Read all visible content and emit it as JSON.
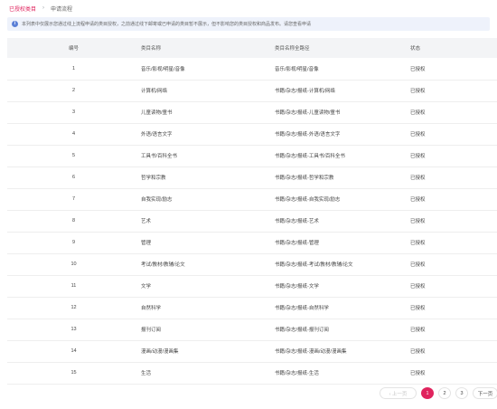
{
  "breadcrumb": {
    "current": "已授权类目",
    "next": "申请流程"
  },
  "notice": {
    "text": "本列表中仅展示您通过线上流程申请的类目授权，之前通过线下邮寄或已申请的类目暂不展示，但不影响您的类目授权和商品发布。请您查看申请"
  },
  "table": {
    "headers": [
      "编号",
      "类目名称",
      "类目名称全路径",
      "状态"
    ],
    "rows": [
      [
        "1",
        "音乐/影视/明星/音像",
        "音乐/影视/明星/音像",
        "已授权"
      ],
      [
        "2",
        "计算机/网络",
        "书籍/杂志/报纸-计算机/网络",
        "已授权"
      ],
      [
        "3",
        "儿童读物/童书",
        "书籍/杂志/报纸-儿童读物/童书",
        "已授权"
      ],
      [
        "4",
        "外语/语言文字",
        "书籍/杂志/报纸-外语/语言文字",
        "已授权"
      ],
      [
        "5",
        "工具书/百科全书",
        "书籍/杂志/报纸-工具书/百科全书",
        "已授权"
      ],
      [
        "6",
        "哲学和宗教",
        "书籍/杂志/报纸-哲学和宗教",
        "已授权"
      ],
      [
        "7",
        "自我实现/励志",
        "书籍/杂志/报纸-自我实现/励志",
        "已授权"
      ],
      [
        "8",
        "艺术",
        "书籍/杂志/报纸-艺术",
        "已授权"
      ],
      [
        "9",
        "管理",
        "书籍/杂志/报纸-管理",
        "已授权"
      ],
      [
        "10",
        "考试/教材/教辅/论文",
        "书籍/杂志/报纸-考试/教材/教辅/论文",
        "已授权"
      ],
      [
        "11",
        "文学",
        "书籍/杂志/报纸-文学",
        "已授权"
      ],
      [
        "12",
        "自然科学",
        "书籍/杂志/报纸-自然科学",
        "已授权"
      ],
      [
        "13",
        "报刊订阅",
        "书籍/杂志/报纸-报刊订阅",
        "已授权"
      ],
      [
        "14",
        "漫画/动漫/漫画集",
        "书籍/杂志/报纸-漫画/动漫/漫画集",
        "已授权"
      ],
      [
        "15",
        "生活",
        "书籍/杂志/报纸-生活",
        "已授权"
      ]
    ]
  },
  "pagination": {
    "prev": "‹ 上一页",
    "pages": [
      "1",
      "2",
      "3"
    ],
    "current": "1",
    "next": "下一页"
  },
  "colors": {
    "accent": "#e0245e",
    "info": "#5b7fd6"
  },
  "icons": {
    "info": "info-icon"
  }
}
